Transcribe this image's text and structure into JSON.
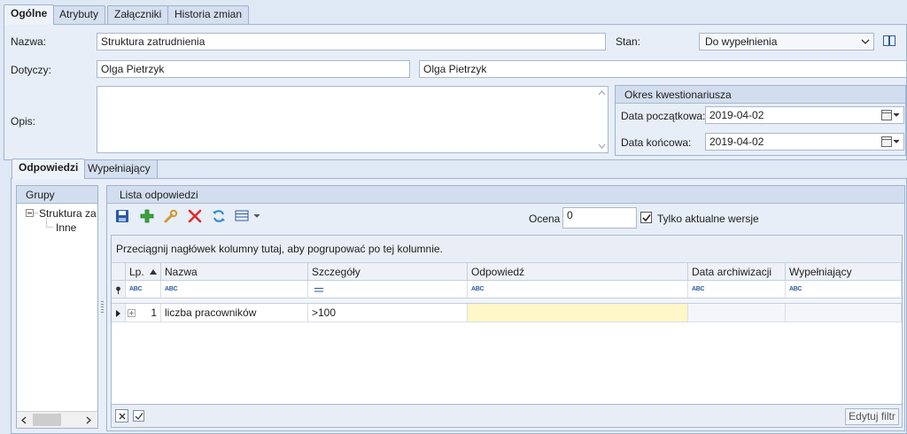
{
  "top_tabs": [
    "Ogólne",
    "Atrybuty",
    "Załączniki",
    "Historia zmian"
  ],
  "form": {
    "nazwa_label": "Nazwa:",
    "nazwa_value": "Struktura zatrudnienia",
    "dotyczy_label": "Dotyczy:",
    "dotyczy_value_1": "Olga Pietrzyk",
    "dotyczy_value_2": "Olga Pietrzyk",
    "opis_label": "Opis:",
    "stan_label": "Stan:",
    "stan_value": "Do wypełnienia"
  },
  "okres": {
    "title": "Okres kwestionariusza",
    "start_label": "Data początkowa:",
    "start_value": "2019-04-02",
    "end_label": "Data końcowa:",
    "end_value": "2019-04-02"
  },
  "lower_tabs": [
    "Odpowiedzi",
    "Wypełniający"
  ],
  "groups": {
    "title": "Grupy",
    "root": "Struktura zatrudnienia",
    "child": "Inne"
  },
  "answers": {
    "title": "Lista odpowiedzi",
    "ocena_label": "Ocena",
    "ocena_value": "0",
    "only_current_label": "Tylko aktualne wersje",
    "only_current_checked": true,
    "group_hint": "Przeciągnij nagłówek kolumny tutaj, aby pogrupować po tej kolumnie.",
    "columns": [
      "Lp.",
      "Nazwa",
      "Szczegóły",
      "Odpowiedź",
      "Data archiwizacji",
      "Wypełniający"
    ],
    "rows": [
      {
        "lp": "1",
        "nazwa": "liczba pracowników",
        "szczegoly": ">100",
        "odpowiedz": "",
        "data_archiwizacji": "",
        "wypelniajacy": ""
      }
    ],
    "edit_filter_label": "Edytuj filtr"
  },
  "colors": {
    "accent": "#2c5aa0",
    "highlight_cell": "#fff7c8",
    "background": "#dfe8f5"
  }
}
